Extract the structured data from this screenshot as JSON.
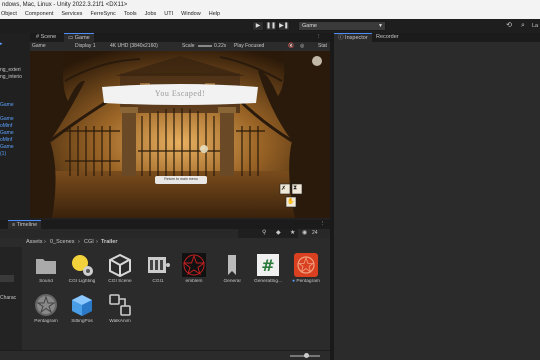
{
  "window": {
    "title": "ndows, Mac, Linux - Unity 2022.3.21f1 <DX11>"
  },
  "menu": [
    "Object",
    "Component",
    "Services",
    "FerreSync",
    "Tools",
    "Jobs",
    "UTI",
    "Window",
    "Help"
  ],
  "toolbar": {
    "play": "▶",
    "pause": "❚❚",
    "step": "▶❚",
    "scene_selector": "Game",
    "layers_label": "La"
  },
  "left_panel": {
    "items": [
      {
        "text": "ng_exteri",
        "blue": false
      },
      {
        "text": "ng_interio",
        "blue": false
      },
      {
        "text": "Game",
        "blue": true
      },
      {
        "text": "Game",
        "blue": true
      },
      {
        "text": "oMinf",
        "blue": true
      },
      {
        "text": "Game",
        "blue": true
      },
      {
        "text": "oMinf",
        "blue": true
      },
      {
        "text": "Game",
        "blue": true
      },
      {
        "text": "(1)",
        "blue": true
      }
    ]
  },
  "game_tabs": {
    "scene": "Scene",
    "game": "Game"
  },
  "game_bar": {
    "mode": "Game",
    "display": "Display 1",
    "resolution": "4K UHD (3840x2160)",
    "scale_label": "Scale",
    "scale_value": "0.22x",
    "play_focus": "Play Focused",
    "stats": "Stat"
  },
  "game_view": {
    "banner": "You Escaped!",
    "button": "Return to main menu"
  },
  "inspector_tabs": {
    "inspector": "Inspector",
    "recorder": "Recorder"
  },
  "timeline_tab": "Timeline",
  "breadcrumb": [
    "Assets",
    "0_Scenes",
    "CGI",
    "Trailer"
  ],
  "project_count": "24",
  "project_left": [
    "Charac"
  ],
  "assets": [
    {
      "name": "Sound",
      "icon": "folder-icon"
    },
    {
      "name": "CGI Lighting",
      "icon": "lighting-icon"
    },
    {
      "name": "CGI Scene",
      "icon": "unity-scene-icon"
    },
    {
      "name": "CGI1",
      "icon": "timeline-icon"
    },
    {
      "name": "emblem",
      "icon": "pentagram-image-icon"
    },
    {
      "name": "General",
      "icon": "bookmark-icon"
    },
    {
      "name": "GeneralSig...",
      "icon": "script-icon"
    },
    {
      "name": "Pentagram",
      "icon": "pentagram-red-icon"
    },
    {
      "name": "Pentagram",
      "icon": "pentagram-gray-icon"
    },
    {
      "name": "SittingPos",
      "icon": "prefab-icon"
    },
    {
      "name": "WalkAnim",
      "icon": "animator-icon"
    }
  ]
}
